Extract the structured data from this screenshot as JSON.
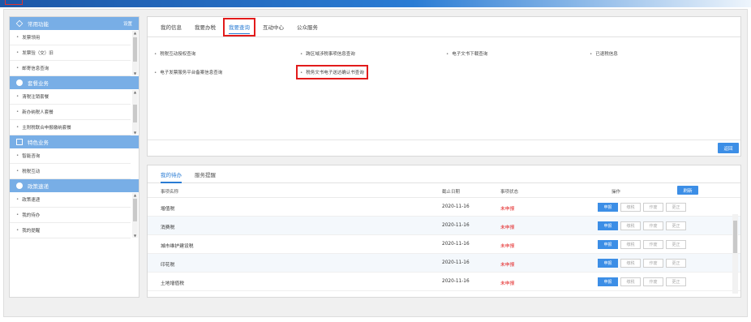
{
  "sidebar": {
    "sections": [
      {
        "title": "常用功能",
        "setting_label": "设置",
        "items": [
          "发票领用",
          "发票验（交）旧",
          "邮寄信息查询"
        ]
      },
      {
        "title": "套餐业务",
        "items": [
          "清税注销套餐",
          "新办纳税人套餐",
          "主附税联合申报缴纳套餐"
        ]
      },
      {
        "title": "特色业务",
        "items": [
          "智能咨询",
          "税税互动"
        ]
      },
      {
        "title": "政策速递",
        "items": [
          "政策速递",
          "我的待办",
          "我的提醒"
        ]
      }
    ]
  },
  "top_panel": {
    "tabs": [
      "我的信息",
      "我要办税",
      "我要查询",
      "互动中心",
      "公众服务"
    ],
    "active_tab": "我要查询",
    "links": [
      "税税互动授权查询",
      "跨区域涉税事项信息查询",
      "电子文书下载查询",
      "已退税信息",
      "电子发票服务平台备案信息查询",
      "税务文书电子送达确认书查询"
    ],
    "return_label": "返回"
  },
  "bottom_panel": {
    "tabs": [
      "我的待办",
      "服务提醒"
    ],
    "active_tab": "我的待办",
    "columns": {
      "name": "事项名称",
      "deadline": "截止日期",
      "status": "事项状态",
      "action": "操作"
    },
    "refresh_label": "刷新",
    "row_actions": [
      "申报",
      "缴税",
      "作废",
      "更正"
    ],
    "rows": [
      {
        "name": "增值税",
        "deadline": "2020-11-16",
        "status": "未申报"
      },
      {
        "name": "消费税",
        "deadline": "2020-11-16",
        "status": "未申报"
      },
      {
        "name": "城市维护建设税",
        "deadline": "2020-11-16",
        "status": "未申报"
      },
      {
        "name": "印花税",
        "deadline": "2020-11-16",
        "status": "未申报"
      },
      {
        "name": "土地增值税",
        "deadline": "2020-11-16",
        "status": "未申报"
      }
    ]
  },
  "colors": {
    "accent": "#3c8ee6",
    "sidebar_header": "#78aee6",
    "highlight_box": "#e21b1b",
    "status_pending": "#e21b1b"
  }
}
